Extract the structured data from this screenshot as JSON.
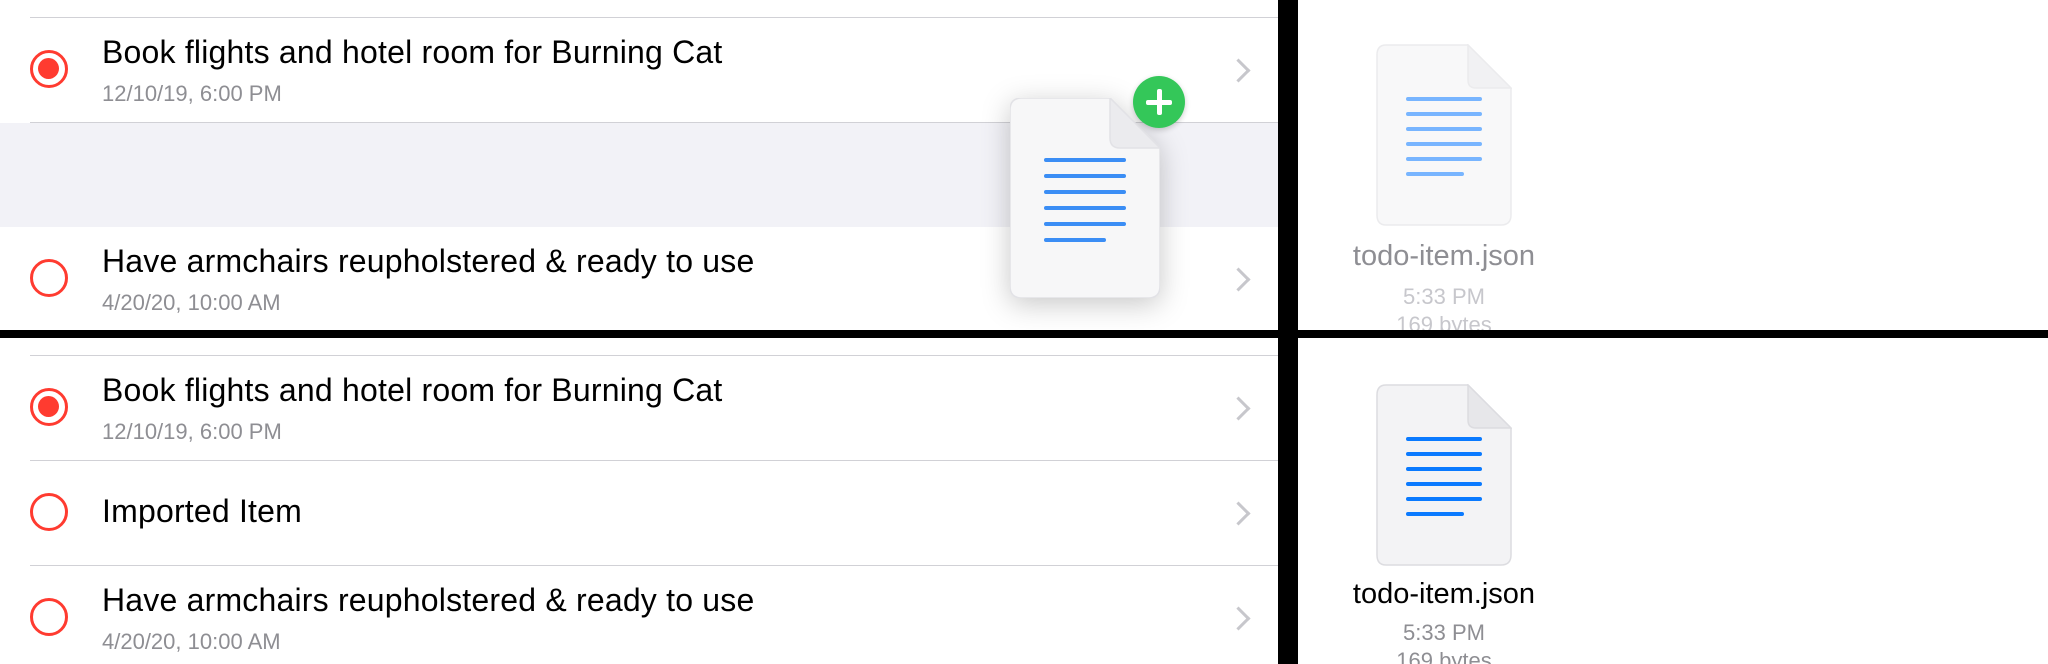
{
  "top_panel": {
    "todo_list": {
      "items": [
        {
          "title": "Book flights and hotel room for Burning Cat",
          "date": "12/10/19, 6:00 PM",
          "completed": true
        },
        {
          "title": "Have armchairs reupholstered & ready to use",
          "date": "4/20/20, 10:00 AM",
          "completed": false
        }
      ],
      "drag_badge_icon": "plus-circle-icon"
    },
    "files": {
      "file": {
        "name": "todo-item.json",
        "time": "5:33 PM",
        "size": "169 bytes",
        "state": "dimmed-dragging"
      }
    }
  },
  "bottom_panel": {
    "todo_list": {
      "items": [
        {
          "title": "Book flights and hotel room for Burning Cat",
          "date": "12/10/19, 6:00 PM",
          "completed": true
        },
        {
          "title": "Imported Item",
          "date": "",
          "completed": false
        },
        {
          "title": "Have armchairs reupholstered & ready to use",
          "date": "4/20/20, 10:00 AM",
          "completed": false
        }
      ]
    },
    "files": {
      "file": {
        "name": "todo-item.json",
        "time": "5:33 PM",
        "size": "169 bytes",
        "state": "normal"
      }
    }
  },
  "colors": {
    "accent_red": "#ff3b30",
    "badge_green": "#34c759",
    "doc_lines_blue": "#0a7aff",
    "separator": "#d1d1d6",
    "secondary_text": "#8e8e93"
  }
}
